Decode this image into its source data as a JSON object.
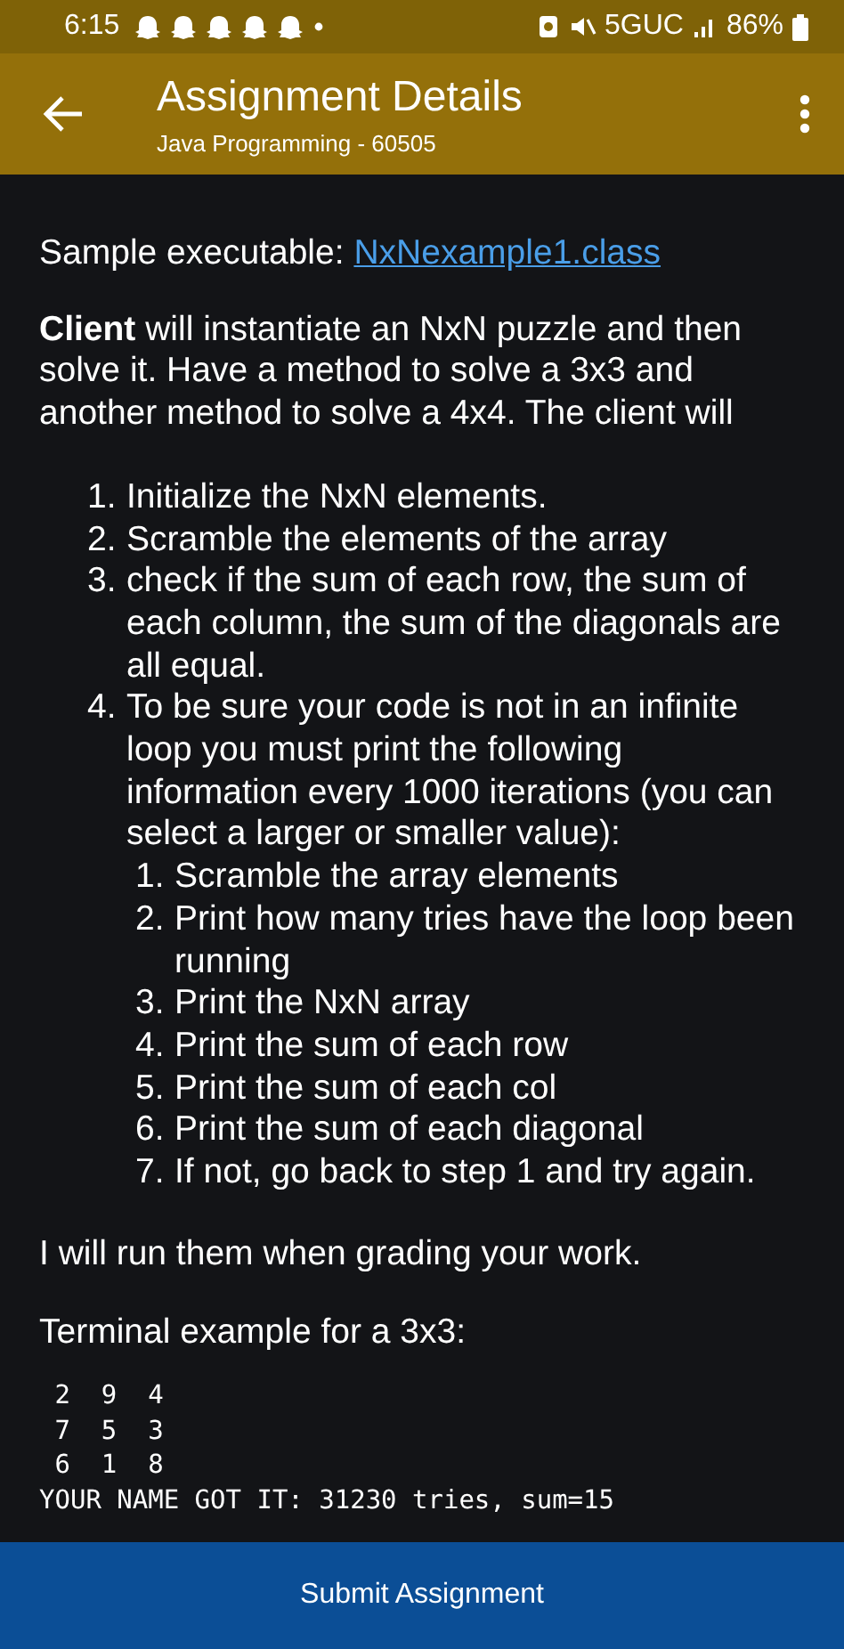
{
  "status_bar": {
    "time": "6:15",
    "network": "5GUC",
    "battery": "86%"
  },
  "header": {
    "title": "Assignment Details",
    "subtitle": "Java Programming - 60505"
  },
  "content": {
    "sample": {
      "label": "Sample executable:",
      "link": "NxNexample1.class"
    },
    "intro": "**Client** will instantiate an NxN puzzle and then solve it. Have a method to solve a 3x3 and another method to solve a 4x4. The client will",
    "steps": [
      {
        "number": "1.",
        "text": "Initialize the NxN elements."
      },
      {
        "number": "2.",
        "text": "Scramble the elements of the array"
      },
      {
        "number": "3.",
        "text": "check if the sum of each row, the sum of each column, the sum of the diagonals are all equal."
      },
      {
        "number": "4.",
        "text": "To be sure your code is not in an infinite loop you must print the following information every 1000 iterations (you can select a larger or smaller value):",
        "children": [
          {
            "number": "1.",
            "text": "Scramble the array elements"
          },
          {
            "number": "2.",
            "text": "Print how many tries have the loop been running"
          },
          {
            "number": "3.",
            "text": "Print the NxN array"
          },
          {
            "number": "4.",
            "text": "Print the sum of each row"
          },
          {
            "number": "5.",
            "text": "Print the sum of each col"
          },
          {
            "number": "6.",
            "text": "Print the sum of each diagonal"
          },
          {
            "number": "7.",
            "text": "If not, go back to step 1 and try again."
          }
        ]
      }
    ],
    "closing": "I will run them when grading your work.",
    "terminal_label": "Terminal example for a 3x3:",
    "terminal_lines": [
      " 2  9  4",
      " 7  5  3",
      " 6  1  8",
      "YOUR NAME GOT IT: 31230 tries, sum=15"
    ]
  },
  "submit_button": "Submit Assignment"
}
